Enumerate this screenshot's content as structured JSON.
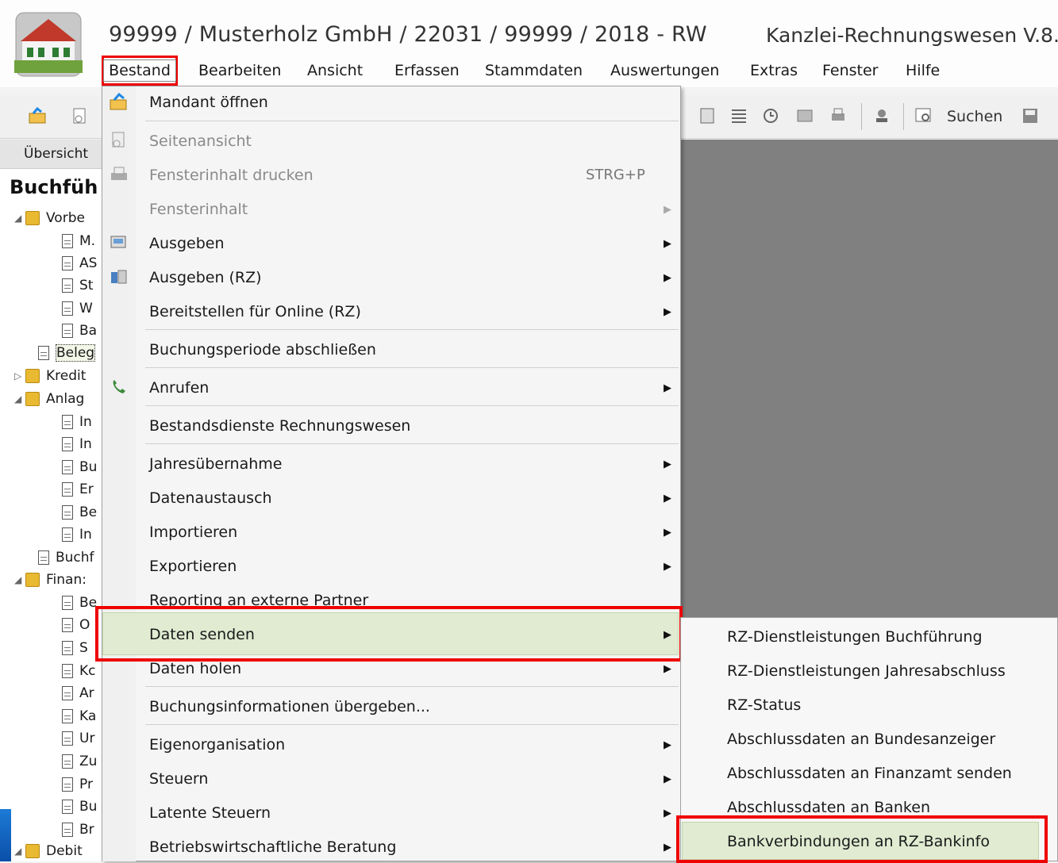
{
  "window": {
    "title": "99999 / Musterholz GmbH / 22031 / 99999 / 2018 - RW",
    "product": "Kanzlei-Rechnungswesen V.8."
  },
  "menubar": {
    "items": [
      "Bestand",
      "Bearbeiten",
      "Ansicht",
      "Erfassen",
      "Stammdaten",
      "Auswertungen",
      "Extras",
      "Fenster",
      "Hilfe"
    ]
  },
  "toolbar": {
    "search_label": "Suchen"
  },
  "sidebar": {
    "overview_label": "Übersicht",
    "title": "Buchfüh",
    "items": [
      "Vorbe",
      "M.",
      "AS",
      "St",
      "W",
      "Ba",
      "Beleg",
      "Kredit",
      "Anlag",
      "In",
      "In",
      "Bu",
      "Er",
      "Be",
      "In",
      "Buchf",
      "Finan:",
      "Be",
      "O",
      "S",
      "Kc",
      "Ar",
      "Ka",
      "Ur",
      "Zu",
      "Pr",
      "Bu",
      "Br",
      "Debit"
    ]
  },
  "dropdown": {
    "items": [
      {
        "label": "Mandant öffnen"
      },
      {
        "label": "Seitenansicht"
      },
      {
        "label": "Fensterinhalt drucken",
        "shortcut": "STRG+P"
      },
      {
        "label": "Fensterinhalt"
      },
      {
        "label": "Ausgeben"
      },
      {
        "label": "Ausgeben (RZ)"
      },
      {
        "label": "Bereitstellen für Online (RZ)"
      },
      {
        "label": "Buchungsperiode abschließen"
      },
      {
        "label": "Anrufen"
      },
      {
        "label": "Bestandsdienste Rechnungswesen"
      },
      {
        "label": "Jahresübernahme"
      },
      {
        "label": "Datenaustausch"
      },
      {
        "label": "Importieren"
      },
      {
        "label": "Exportieren"
      },
      {
        "label": "Reporting an externe Partner"
      },
      {
        "label": "Daten senden"
      },
      {
        "label": "Daten holen"
      },
      {
        "label": "Buchungsinformationen übergeben..."
      },
      {
        "label": "Eigenorganisation"
      },
      {
        "label": "Steuern"
      },
      {
        "label": "Latente Steuern"
      },
      {
        "label": "Betriebswirtschaftliche Beratung"
      }
    ]
  },
  "submenu": {
    "items": [
      "RZ-Dienstleistungen Buchführung",
      "RZ-Dienstleistungen Jahresabschluss",
      "RZ-Status",
      "Abschlussdaten an Bundesanzeiger",
      "Abschlussdaten an Finanzamt senden",
      "Abschlussdaten an Banken",
      "Bankverbindungen an RZ-Bankinfo"
    ]
  },
  "colors": {
    "highlight": "#e0ebd2",
    "annotation_red": "#ee0000",
    "workspace": "#808080"
  }
}
